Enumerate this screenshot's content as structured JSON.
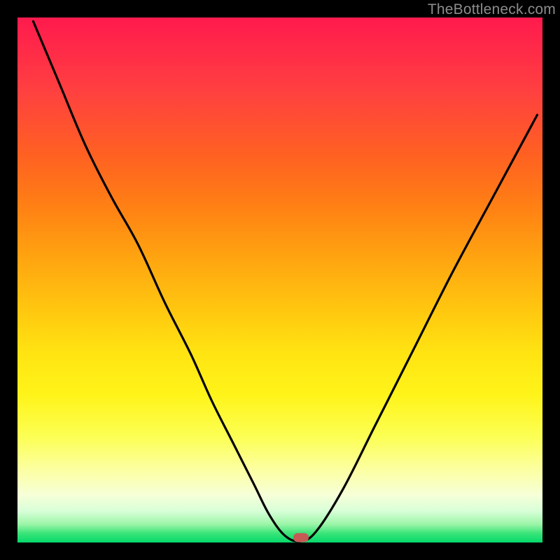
{
  "watermark": "TheBottleneck.com",
  "marker": {
    "x_pct": 54.0,
    "y_pct": 99.1
  },
  "chart_data": {
    "type": "line",
    "title": "",
    "xlabel": "",
    "ylabel": "",
    "xlim": [
      0,
      100
    ],
    "ylim": [
      0,
      100
    ],
    "series": [
      {
        "name": "bottleneck-curve",
        "x": [
          3,
          8,
          13,
          18,
          23,
          28,
          33,
          37,
          41,
          45,
          48,
          51,
          54,
          57,
          62,
          68,
          75,
          83,
          91,
          99
        ],
        "values": [
          100,
          88,
          76,
          66,
          57,
          46,
          36,
          27,
          19,
          11,
          5,
          1,
          0,
          2,
          10,
          22,
          36,
          52,
          67,
          82
        ]
      }
    ],
    "annotations": [
      {
        "type": "marker",
        "x": 54,
        "y": 0.9,
        "label": "optimal-point"
      }
    ],
    "gradient_stops": [
      {
        "pct": 0,
        "color": "#ff1a4d"
      },
      {
        "pct": 26,
        "color": "#ff6022"
      },
      {
        "pct": 56,
        "color": "#ffc80f"
      },
      {
        "pct": 80,
        "color": "#fcff55"
      },
      {
        "pct": 96,
        "color": "#9cf5a8"
      },
      {
        "pct": 100,
        "color": "#05d96b"
      }
    ]
  }
}
